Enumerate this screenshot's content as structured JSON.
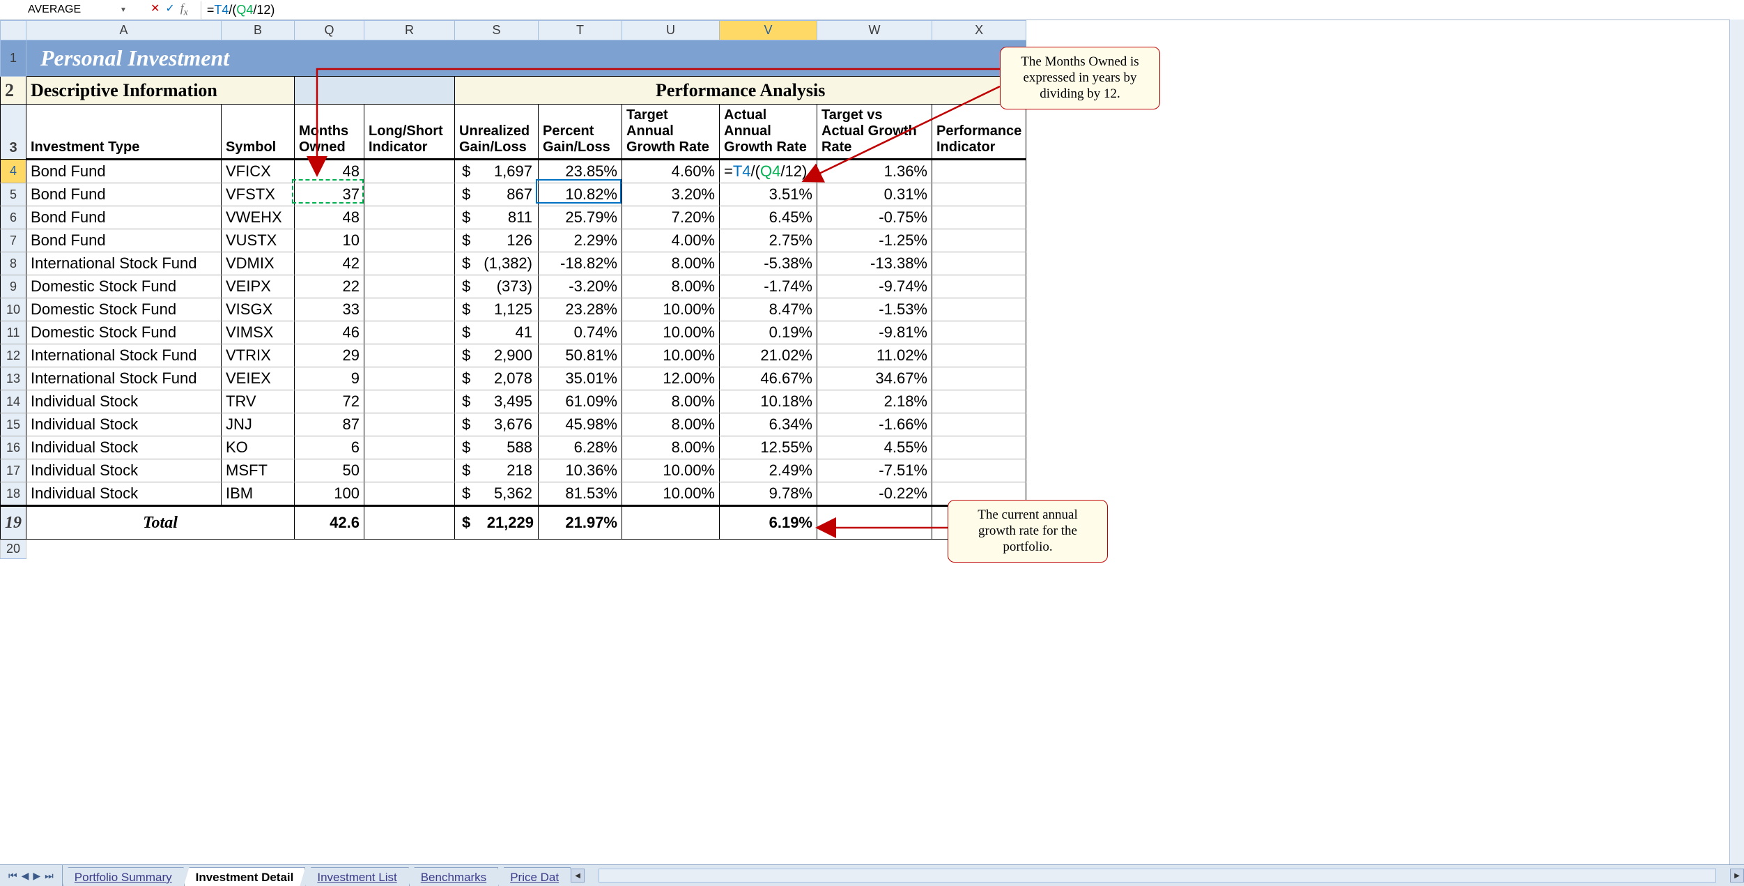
{
  "name_box": "AVERAGE",
  "formula": "=T4/(Q4/12)",
  "columns": [
    "A",
    "B",
    "Q",
    "R",
    "S",
    "T",
    "U",
    "V",
    "W",
    "X"
  ],
  "active_col": "V",
  "active_row": "4",
  "title": "Personal Investment",
  "section_left": "Descriptive Information",
  "section_right": "Performance Analysis",
  "headers": {
    "A": "Investment Type",
    "B": "Symbol",
    "Q": "Months Owned",
    "R": "Long/Short Indicator",
    "S": "Unrealized Gain/Loss",
    "T": "Percent Gain/Loss",
    "U": "Target Annual Growth Rate",
    "V": "Actual Annual Growth Rate",
    "W": "Target vs Actual Growth Rate",
    "X": "Performance Indicator"
  },
  "rows": [
    {
      "n": "4",
      "A": "Bond Fund",
      "B": "VFICX",
      "Q": "48",
      "R": "",
      "S": "1,697",
      "T": "23.85%",
      "U": "4.60%",
      "V": "=T4/(Q4/12)",
      "W": "1.36%",
      "X": "",
      "edit": true
    },
    {
      "n": "5",
      "A": "Bond Fund",
      "B": "VFSTX",
      "Q": "37",
      "R": "",
      "S": "867",
      "T": "10.82%",
      "U": "3.20%",
      "V": "3.51%",
      "W": "0.31%",
      "X": ""
    },
    {
      "n": "6",
      "A": "Bond Fund",
      "B": "VWEHX",
      "Q": "48",
      "R": "",
      "S": "811",
      "T": "25.79%",
      "U": "7.20%",
      "V": "6.45%",
      "W": "-0.75%",
      "X": ""
    },
    {
      "n": "7",
      "A": "Bond Fund",
      "B": "VUSTX",
      "Q": "10",
      "R": "",
      "S": "126",
      "T": "2.29%",
      "U": "4.00%",
      "V": "2.75%",
      "W": "-1.25%",
      "X": ""
    },
    {
      "n": "8",
      "A": "International Stock Fund",
      "B": "VDMIX",
      "Q": "42",
      "R": "",
      "S": "(1,382)",
      "T": "-18.82%",
      "U": "8.00%",
      "V": "-5.38%",
      "W": "-13.38%",
      "X": ""
    },
    {
      "n": "9",
      "A": "Domestic Stock Fund",
      "B": "VEIPX",
      "Q": "22",
      "R": "",
      "S": "(373)",
      "T": "-3.20%",
      "U": "8.00%",
      "V": "-1.74%",
      "W": "-9.74%",
      "X": ""
    },
    {
      "n": "10",
      "A": "Domestic Stock Fund",
      "B": "VISGX",
      "Q": "33",
      "R": "",
      "S": "1,125",
      "T": "23.28%",
      "U": "10.00%",
      "V": "8.47%",
      "W": "-1.53%",
      "X": ""
    },
    {
      "n": "11",
      "A": "Domestic Stock Fund",
      "B": "VIMSX",
      "Q": "46",
      "R": "",
      "S": "41",
      "T": "0.74%",
      "U": "10.00%",
      "V": "0.19%",
      "W": "-9.81%",
      "X": ""
    },
    {
      "n": "12",
      "A": "International Stock Fund",
      "B": "VTRIX",
      "Q": "29",
      "R": "",
      "S": "2,900",
      "T": "50.81%",
      "U": "10.00%",
      "V": "21.02%",
      "W": "11.02%",
      "X": ""
    },
    {
      "n": "13",
      "A": "International Stock Fund",
      "B": "VEIEX",
      "Q": "9",
      "R": "",
      "S": "2,078",
      "T": "35.01%",
      "U": "12.00%",
      "V": "46.67%",
      "W": "34.67%",
      "X": ""
    },
    {
      "n": "14",
      "A": "Individual Stock",
      "B": "TRV",
      "Q": "72",
      "R": "",
      "S": "3,495",
      "T": "61.09%",
      "U": "8.00%",
      "V": "10.18%",
      "W": "2.18%",
      "X": ""
    },
    {
      "n": "15",
      "A": "Individual Stock",
      "B": "JNJ",
      "Q": "87",
      "R": "",
      "S": "3,676",
      "T": "45.98%",
      "U": "8.00%",
      "V": "6.34%",
      "W": "-1.66%",
      "X": ""
    },
    {
      "n": "16",
      "A": "Individual Stock",
      "B": "KO",
      "Q": "6",
      "R": "",
      "S": "588",
      "T": "6.28%",
      "U": "8.00%",
      "V": "12.55%",
      "W": "4.55%",
      "X": ""
    },
    {
      "n": "17",
      "A": "Individual Stock",
      "B": "MSFT",
      "Q": "50",
      "R": "",
      "S": "218",
      "T": "10.36%",
      "U": "10.00%",
      "V": "2.49%",
      "W": "-7.51%",
      "X": ""
    },
    {
      "n": "18",
      "A": "Individual Stock",
      "B": "IBM",
      "Q": "100",
      "R": "",
      "S": "5,362",
      "T": "81.53%",
      "U": "10.00%",
      "V": "9.78%",
      "W": "-0.22%",
      "X": ""
    }
  ],
  "total": {
    "label": "Total",
    "Q": "42.6",
    "S": "21,229",
    "T": "21.97%",
    "V": "6.19%"
  },
  "tabs": [
    "Portfolio Summary",
    "Investment Detail",
    "Investment List",
    "Benchmarks",
    "Price Dat"
  ],
  "active_tab": 1,
  "callout1": "The Months Owned is expressed in years by dividing by 12.",
  "callout2": "The current annual growth rate for the portfolio.",
  "chart_data": {
    "type": "table",
    "title": "Personal Investment — Performance Analysis",
    "columns": [
      "Investment Type",
      "Symbol",
      "Months Owned",
      "Unrealized Gain/Loss ($)",
      "Percent Gain/Loss (%)",
      "Target Annual Growth Rate (%)",
      "Actual Annual Growth Rate (%)",
      "Target vs Actual Growth Rate (%)"
    ],
    "rows": [
      [
        "Bond Fund",
        "VFICX",
        48,
        1697,
        23.85,
        4.6,
        null,
        1.36
      ],
      [
        "Bond Fund",
        "VFSTX",
        37,
        867,
        10.82,
        3.2,
        3.51,
        0.31
      ],
      [
        "Bond Fund",
        "VWEHX",
        48,
        811,
        25.79,
        7.2,
        6.45,
        -0.75
      ],
      [
        "Bond Fund",
        "VUSTX",
        10,
        126,
        2.29,
        4.0,
        2.75,
        -1.25
      ],
      [
        "International Stock Fund",
        "VDMIX",
        42,
        -1382,
        -18.82,
        8.0,
        -5.38,
        -13.38
      ],
      [
        "Domestic Stock Fund",
        "VEIPX",
        22,
        -373,
        -3.2,
        8.0,
        -1.74,
        -9.74
      ],
      [
        "Domestic Stock Fund",
        "VISGX",
        33,
        1125,
        23.28,
        10.0,
        8.47,
        -1.53
      ],
      [
        "Domestic Stock Fund",
        "VIMSX",
        46,
        41,
        0.74,
        10.0,
        0.19,
        -9.81
      ],
      [
        "International Stock Fund",
        "VTRIX",
        29,
        2900,
        50.81,
        10.0,
        21.02,
        11.02
      ],
      [
        "International Stock Fund",
        "VEIEX",
        9,
        2078,
        35.01,
        12.0,
        46.67,
        34.67
      ],
      [
        "Individual Stock",
        "TRV",
        72,
        3495,
        61.09,
        8.0,
        10.18,
        2.18
      ],
      [
        "Individual Stock",
        "JNJ",
        87,
        3676,
        45.98,
        8.0,
        6.34,
        -1.66
      ],
      [
        "Individual Stock",
        "KO",
        6,
        588,
        6.28,
        8.0,
        12.55,
        4.55
      ],
      [
        "Individual Stock",
        "MSFT",
        50,
        218,
        10.36,
        10.0,
        2.49,
        -7.51
      ],
      [
        "Individual Stock",
        "IBM",
        100,
        5362,
        81.53,
        10.0,
        9.78,
        -0.22
      ]
    ],
    "totals": {
      "Months Owned": 42.6,
      "Unrealized Gain/Loss ($)": 21229,
      "Percent Gain/Loss (%)": 21.97,
      "Actual Annual Growth Rate (%)": 6.19
    }
  }
}
